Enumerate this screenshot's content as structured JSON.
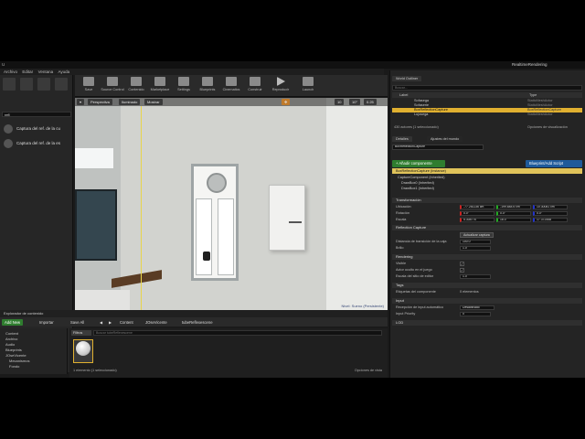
{
  "window": {
    "title": "RealtimeRendering",
    "controls": [
      "_",
      "□",
      "×"
    ]
  },
  "menu": [
    "Archivo",
    "Editar",
    "Ventana",
    "Ayuda"
  ],
  "toolbar": [
    {
      "label": "Save",
      "icon": "save-icon"
    },
    {
      "label": "Source Control",
      "icon": "source-control-icon"
    },
    {
      "label": "Contenido",
      "icon": "content-icon"
    },
    {
      "label": "Marketplace",
      "icon": "marketplace-icon"
    },
    {
      "label": "Settings",
      "icon": "settings-icon"
    },
    {
      "label": "Blueprints",
      "icon": "blueprints-icon"
    },
    {
      "label": "Cinematics",
      "icon": "cinematics-icon"
    },
    {
      "label": "Construir",
      "icon": "build-icon"
    },
    {
      "label": "Reproducir",
      "icon": "play-icon"
    },
    {
      "label": "Launch",
      "icon": "launch-icon"
    }
  ],
  "place": {
    "search_placeholder": "refl",
    "items": [
      "Captura del ref. de la cu",
      "Captura del ref. de la es"
    ]
  },
  "viewport": {
    "buttons": [
      "Perspectiva",
      "Iluminado",
      "Mostrar"
    ],
    "snap": [
      "10",
      "10°",
      "0.25"
    ],
    "level_label": "Nivel: Sueno (Persistente)"
  },
  "content_browser": {
    "tab": "Explorador de contenido",
    "add_new": "Add New",
    "import": "Importar",
    "save_all": "Save All",
    "path": [
      "Content",
      "JOseVicente",
      "tubeReflexescene"
    ],
    "filters": "Filtros",
    "search_placeholder": "Buscar tubeReflexescene",
    "tree": [
      "Content",
      "Archivo",
      "Audio",
      "Blueprints",
      "JOseVicente",
      "Mecanismos",
      "Fondo"
    ],
    "status": "1 elemento (1 seleccionado)",
    "view_options": "Opciones de vista"
  },
  "outliner": {
    "tab": "World Outliner",
    "search_placeholder": "Buscar...",
    "col_label": "Label",
    "col_type": "Type",
    "rows": [
      {
        "name": "Sofasega",
        "type": "StaticMeshActor"
      },
      {
        "name": "Sofaserie",
        "type": "StaticMeshActor"
      },
      {
        "name": "BoxReflectionCapture",
        "type": "BoxReflectionCapture"
      },
      {
        "name": "Lujosega",
        "type": "StaticMeshActor"
      }
    ],
    "footer": "430 actores (1 seleccionado)",
    "view_options": "Opciones de visualización"
  },
  "details": {
    "tab": "Detalles",
    "tab2": "Ajustes del mundo",
    "name_value": "BoxReflectionCapture",
    "add_component": "+ Añadir componente",
    "blueprint_button": "Blueprint/Add Script",
    "component_selected": "BoxReflectionCapture (Instance)",
    "components": [
      "CaptureComponent (Inherited)",
      "DrawBox0 (Inherited)",
      "DrawBox1 (Inherited)"
    ],
    "sections": {
      "transform": "Transformación",
      "reflection": "Reflection Capture",
      "rendering": "Rendering",
      "tags": "Tags",
      "input": "Input",
      "lod": "LOD"
    },
    "transform": {
      "location_label": "Ubicación",
      "rotation_label": "Rotación",
      "scale_label": "Escala",
      "location": [
        "-77.281136 cm",
        "-199.848.6 cm",
        "10.30081 cm"
      ],
      "rotation": [
        "0.0°",
        "0.0°",
        "0.0°"
      ],
      "scale": [
        "5.308770",
        "16.0",
        "17.372458"
      ]
    },
    "reflection": {
      "update_button": "Actualizar captura",
      "distance_label": "Distancia de transición de la caja",
      "distance_value": "100.0",
      "brightness_label": "Brillo",
      "brightness_value": "1.0"
    },
    "rendering": {
      "visible_label": "Visible",
      "hidden_label": "Actor oculto en el juego",
      "billboard_label": "Escala del sitio de editor",
      "billboard_value": "1.0"
    },
    "tags": {
      "label": "Etiquetas del componente",
      "value": "0 elementos"
    },
    "input": {
      "auto_label": "Recepción de input automático",
      "auto_value": "Desactivado",
      "priority_label": "Input Priority",
      "priority_value": "0"
    }
  },
  "colors": {
    "add_new": "#2f7d2f",
    "accent": "#e0c35a",
    "blueprint": "#1f5a9a"
  }
}
